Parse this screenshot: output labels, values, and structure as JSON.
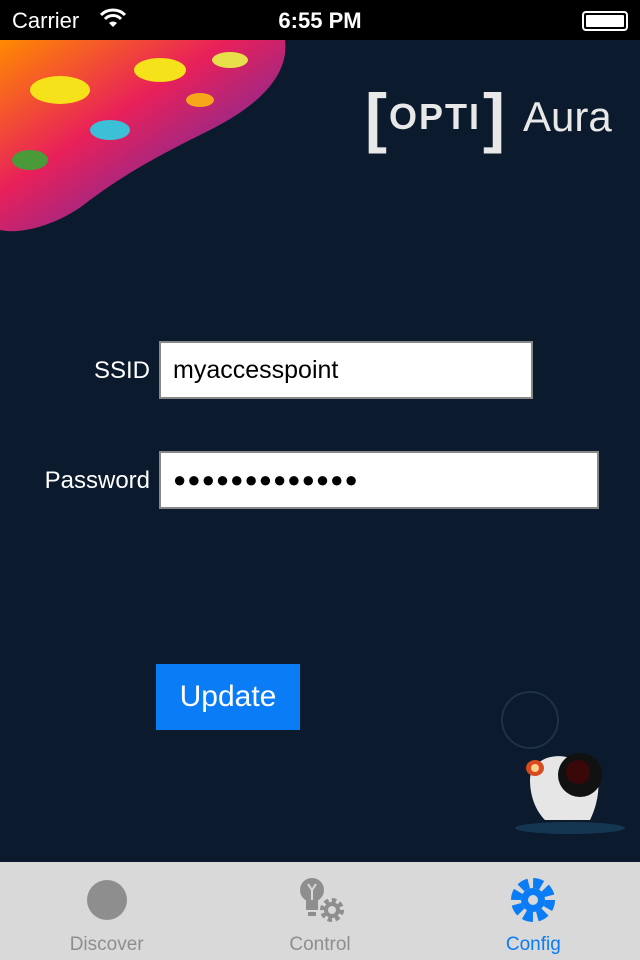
{
  "status_bar": {
    "carrier": "Carrier",
    "time": "6:55 PM",
    "wifi_icon": "wifi-icon",
    "battery_icon": "battery-icon"
  },
  "logo": {
    "left_bracket": "[",
    "opti": "OPTI",
    "right_bracket": "]",
    "product": "Aura"
  },
  "form": {
    "ssid_label": "SSID",
    "ssid_value": "myaccesspoint",
    "password_label": "Password",
    "password_value": "●●●●●●●●●●●●●"
  },
  "update_label": "Update",
  "tabs": [
    {
      "label": "Discover",
      "icon": "circle-icon",
      "active": false
    },
    {
      "label": "Control",
      "icon": "bulb-gear-icon",
      "active": false
    },
    {
      "label": "Config",
      "icon": "gear-icon",
      "active": true
    }
  ],
  "colors": {
    "background": "#0b1a2c",
    "accent": "#0a7cf5",
    "tabbar": "#d9d9d9"
  }
}
